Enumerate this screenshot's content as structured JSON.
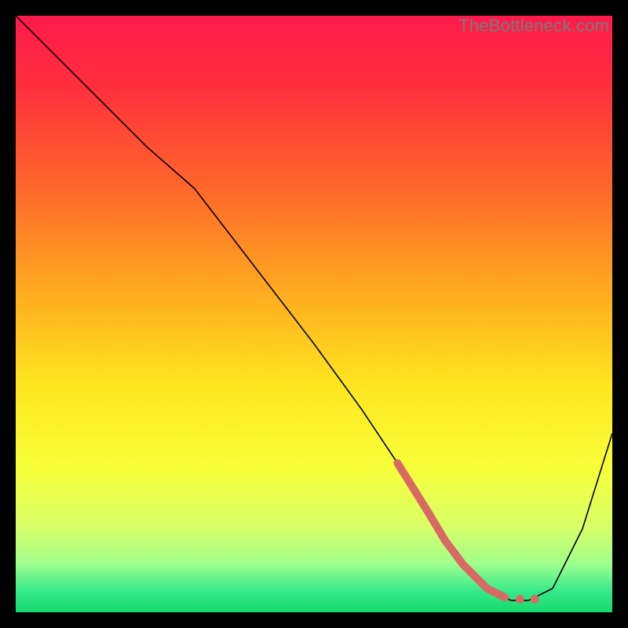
{
  "watermark": "TheBottleneck.com",
  "chart_data": {
    "type": "line",
    "title": "",
    "xlabel": "",
    "ylabel": "",
    "xlim": [
      0,
      100
    ],
    "ylim": [
      0,
      100
    ],
    "background_gradient": {
      "stops": [
        {
          "offset": 0.0,
          "color": "#ff1a4b"
        },
        {
          "offset": 0.12,
          "color": "#ff2f3d"
        },
        {
          "offset": 0.3,
          "color": "#ff6b2a"
        },
        {
          "offset": 0.48,
          "color": "#ffb11f"
        },
        {
          "offset": 0.62,
          "color": "#ffe61f"
        },
        {
          "offset": 0.76,
          "color": "#f7ff3a"
        },
        {
          "offset": 0.86,
          "color": "#d6ff6a"
        },
        {
          "offset": 0.92,
          "color": "#9dff8d"
        },
        {
          "offset": 0.965,
          "color": "#35e98a"
        },
        {
          "offset": 1.0,
          "color": "#16d96e"
        }
      ]
    },
    "series": [
      {
        "name": "bottleneck-curve",
        "color": "#000000",
        "width": 1.6,
        "x": [
          0,
          6,
          14,
          22,
          30,
          40,
          50,
          58,
          64,
          69,
          72,
          75,
          79,
          83,
          86,
          90,
          95,
          100
        ],
        "y": [
          100,
          94,
          86,
          78,
          71,
          58,
          45,
          34,
          25,
          17,
          12,
          8,
          4,
          2,
          2,
          4,
          14,
          30
        ]
      }
    ],
    "highlight": {
      "name": "optimal-range",
      "color": "#d86a63",
      "width": 10,
      "cap": "round",
      "x": [
        64,
        69,
        72,
        75,
        79,
        82
      ],
      "y": [
        25,
        17,
        12,
        8,
        4,
        2.5
      ]
    },
    "highlight_dots": {
      "color": "#d86a63",
      "r": 5.5,
      "points": [
        {
          "x": 84.5,
          "y": 2.2
        },
        {
          "x": 87.0,
          "y": 2.2
        }
      ]
    }
  }
}
